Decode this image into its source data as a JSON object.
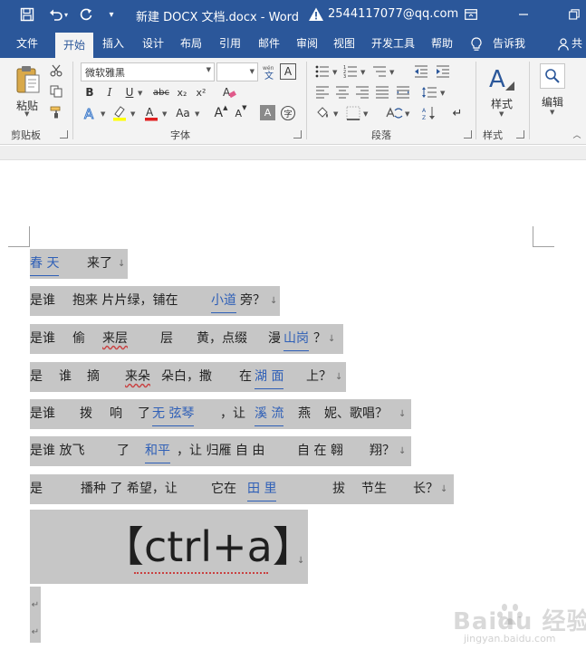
{
  "titlebar": {
    "title": "新建 DOCX 文档.docx  -  Word",
    "user": "2544117077@qq.com"
  },
  "tabs": [
    "文件",
    "开始",
    "插入",
    "设计",
    "布局",
    "引用",
    "邮件",
    "审阅",
    "视图",
    "开发工具",
    "帮助",
    "告诉我",
    "共"
  ],
  "active_tab": "开始",
  "ribbon": {
    "clipboard": {
      "paste_label": "粘贴",
      "group_label": "剪贴板"
    },
    "font": {
      "font_name": "微软雅黑",
      "font_size": "",
      "bold": "B",
      "italic": "I",
      "underline": "U",
      "strike": "abc",
      "subscript": "x₂",
      "superscript": "x²",
      "grow": "A",
      "shrink": "A",
      "case": "Aa",
      "group_label": "字体"
    },
    "paragraph": {
      "group_label": "段落"
    },
    "styles": {
      "styles_label": "样式",
      "group_label": "样式"
    },
    "editing": {
      "editing_label": "编辑"
    }
  },
  "document": {
    "lines": [
      {
        "segments": [
          {
            "t": "春  天",
            "link": true
          },
          {
            "t": "来了"
          }
        ]
      },
      {
        "segments": [
          {
            "t": "是谁"
          },
          {
            "t": "抱来  片片绿，铺在"
          },
          {
            "t": "小道",
            "link": true
          },
          {
            "t": "旁？"
          }
        ]
      },
      {
        "segments": [
          {
            "t": "是谁"
          },
          {
            "t": "偷"
          },
          {
            "t": "来层",
            "squig": true
          },
          {
            "t": "层"
          },
          {
            "t": "黄，点缀"
          },
          {
            "t": "漫"
          },
          {
            "t": "山岗",
            "link": true
          },
          {
            "t": "？"
          }
        ]
      },
      {
        "segments": [
          {
            "t": "是"
          },
          {
            "t": "谁"
          },
          {
            "t": "摘"
          },
          {
            "t": "来朵",
            "squig": true
          },
          {
            "t": "朵白，撒"
          },
          {
            "t": "在"
          },
          {
            "t": "湖    面",
            "link": true
          },
          {
            "t": "上？"
          }
        ]
      },
      {
        "segments": [
          {
            "t": "是谁"
          },
          {
            "t": "拨"
          },
          {
            "t": "响"
          },
          {
            "t": "了"
          },
          {
            "t": "无    弦琴",
            "link": true
          },
          {
            "t": "，让"
          },
          {
            "t": "溪 流",
            "link": true
          },
          {
            "t": "燕"
          },
          {
            "t": "妮、歌唱？"
          }
        ]
      },
      {
        "segments": [
          {
            "t": "是谁 放飞"
          },
          {
            "t": "了"
          },
          {
            "t": "和平",
            "link": true
          },
          {
            "t": "，让 归雁 自 由"
          },
          {
            "t": "自 在 翱"
          },
          {
            "t": "翔？"
          }
        ]
      },
      {
        "segments": [
          {
            "t": "是"
          },
          {
            "t": "播种 了 希望，让"
          },
          {
            "t": "它在"
          },
          {
            "t": "田   里",
            "link": true
          },
          {
            "t": "拔"
          },
          {
            "t": "节生"
          },
          {
            "t": "长？"
          }
        ]
      }
    ],
    "big_text": "【ctrl+a】"
  },
  "watermark": {
    "brand": "Baidu 经验",
    "url": "jingyan.baidu.com"
  },
  "colors": {
    "accent": "#2b579a",
    "ribbon_bg": "#f3f3f3",
    "selection": "#c6c6c6",
    "link": "#2e5fb7"
  }
}
